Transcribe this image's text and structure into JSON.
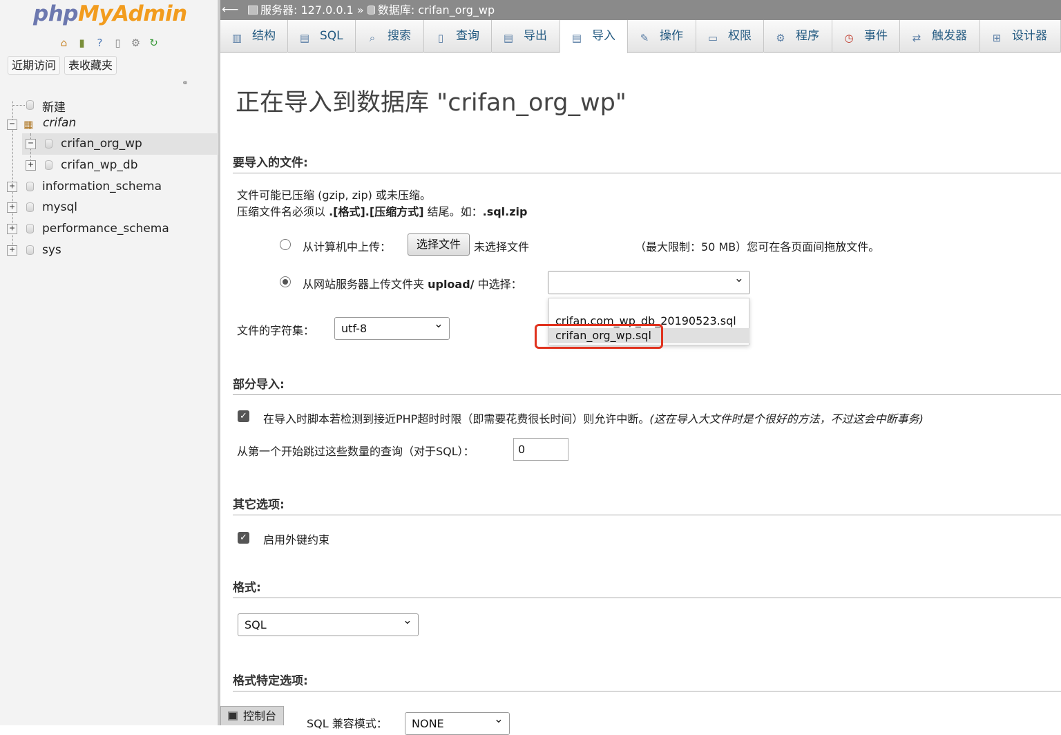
{
  "nav": {
    "logo_part1": "php",
    "logo_part2": "MyAdmin",
    "icons": [
      "home-icon",
      "logout-icon",
      "help-icon",
      "docs-icon",
      "settings-icon",
      "reload-icon"
    ],
    "buttons": [
      "近期访问",
      "表收藏夹"
    ],
    "tree": {
      "new": "新建",
      "server_group": "crifan",
      "databases": [
        "crifan_org_wp",
        "crifan_wp_db",
        "information_schema",
        "mysql",
        "performance_schema",
        "sys"
      ]
    }
  },
  "topbar": {
    "server": "服务器: 127.0.0.1",
    "separator": "»",
    "database": "数据库: crifan_org_wp"
  },
  "tabs": [
    "结构",
    "SQL",
    "搜索",
    "查询",
    "导出",
    "导入",
    "操作",
    "权限",
    "程序",
    "事件",
    "触发器",
    "设计器"
  ],
  "active_tab": "导入",
  "main": {
    "title": "正在导入到数据库 \"crifan_org_wp\"",
    "file_section": "要导入的文件:",
    "compress_note1": "文件可能已压缩 (gzip, zip) 或未压缩。",
    "compress_note2_a": "压缩文件名必须以 ",
    "compress_note2_b": ".[格式].[压缩方式]",
    "compress_note2_c": " 结尾。如：",
    "compress_note2_d": ".sql.zip",
    "upload_local_label": "从计算机中上传：",
    "choose_file_button": "选择文件",
    "no_file_chosen": "未选择文件",
    "max_size_note": "（最大限制：50 MB）您可在各页面间拖放文件。",
    "upload_server_label_a": "从网站服务器上传文件夹 ",
    "upload_server_label_b": "upload/",
    "upload_server_label_c": " 中选择：",
    "server_file_select_value": "",
    "server_file_options": [
      "crifan.com_wp_db_20190523.sql",
      "crifan_org_wp.sql"
    ],
    "highlighted_option": "crifan_org_wp.sql",
    "charset_label": "文件的字符集：",
    "charset_value": "utf-8",
    "partial_section": "部分导入:",
    "interrupt_checkbox_label": "在导入时脚本若检测到接近PHP超时时限（即需要花费很长时间）则允许中断。",
    "interrupt_checkbox_hint": "(这在导入大文件时是个很好的方法，不过这会中断事务)",
    "interrupt_checked": true,
    "skip_queries_label": "从第一个开始跳过这些数量的查询（对于SQL）：",
    "skip_queries_value": "0",
    "other_section": "其它选项:",
    "fk_checkbox_label": "启用外键约束",
    "fk_checked": true,
    "format_section": "格式:",
    "format_value": "SQL",
    "format_specific_section": "格式特定选项:",
    "sql_compat_label": "SQL 兼容模式：",
    "sql_compat_value": "NONE",
    "console_label": "控制台"
  }
}
